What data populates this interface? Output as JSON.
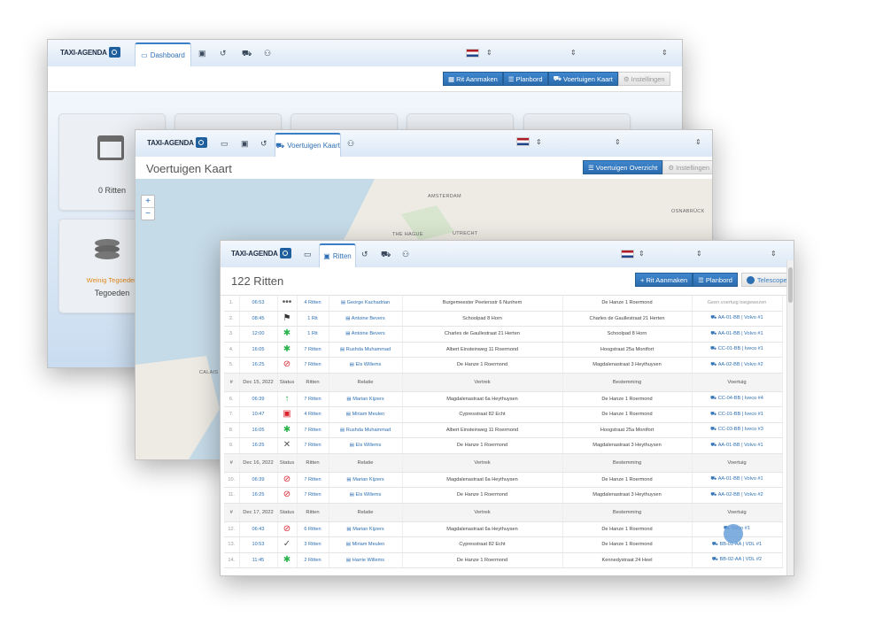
{
  "app": {
    "logo_text": "TAXI-AGENDA",
    "accent_color": "#2d6fb3"
  },
  "window1": {
    "active_tab": "Dashboard",
    "buttons": [
      "Rit Aanmaken",
      "Planbord",
      "Voertuigen Kaart",
      "Instellingen"
    ],
    "cards": [
      {
        "label": "0 Ritten"
      },
      {
        "label": "Weinig Tegoeden",
        "label2": "Tegoeden"
      }
    ]
  },
  "window2": {
    "active_tab": "Voertuigen Kaart",
    "title": "Voertuigen Kaart",
    "buttons": [
      "Voertuigen Overzicht",
      "Instellingen"
    ],
    "map_labels": [
      "AMSTERDAM",
      "THE HAGUE",
      "UTRECHT",
      "OSNABRÜCK",
      "CALAIS"
    ]
  },
  "window3": {
    "active_tab": "Ritten",
    "title": "122 Ritten",
    "buttons": [
      "+ Rit Aanmaken",
      "Planbord",
      "Telescope"
    ],
    "headers": [
      "#",
      "Status",
      "Ritten",
      "Relatie",
      "Vertrek",
      "Bestemming",
      "Voertuig"
    ],
    "groups": [
      {
        "date": null,
        "rows": [
          {
            "n": "1.",
            "time": "06:53",
            "status": "dots",
            "ritten": "4 Ritten",
            "relatie": "George Kachadrian",
            "vertrek": "Burgemeester Peetersstr 6 Nunhem",
            "bestemming": "De Hanze 1 Roermond",
            "voertuig": "Geen voertuig toegewezen"
          },
          {
            "n": "2.",
            "time": "08:45",
            "status": "flag",
            "ritten": "1 Rit",
            "relatie": "Antoine Bevers",
            "vertrek": "Schoolpad 8 Horn",
            "bestemming": "Charles de Gaullestraat 21 Herten",
            "voertuig": "AA-01-BB | Volvo #1"
          },
          {
            "n": "3.",
            "time": "12:00",
            "status": "star",
            "ritten": "1 Rit",
            "relatie": "Antoine Bevers",
            "vertrek": "Charles de Gaullestraat 21 Herten",
            "bestemming": "Schoolpad 8 Horn",
            "voertuig": "AA-01-BB | Volvo #1"
          },
          {
            "n": "4.",
            "time": "16:05",
            "status": "star",
            "ritten": "7 Ritten",
            "relatie": "Rushda Muhammad",
            "vertrek": "Albert Einsteinweg 11 Roermond",
            "bestemming": "Hoogstraat 25a Montfort",
            "voertuig": "CC-01-BB | Iveco #1"
          },
          {
            "n": "5.",
            "time": "16:25",
            "status": "ban",
            "ritten": "7 Ritten",
            "relatie": "Els Willems",
            "vertrek": "De Hanze 1 Roermond",
            "bestemming": "Magdalenastraat 3 Heythuysen",
            "voertuig": "AA-02-BB | Volvo #2"
          }
        ]
      },
      {
        "date": "Dec 15, 2022",
        "rows": [
          {
            "n": "6.",
            "time": "06:39",
            "status": "up",
            "ritten": "7 Ritten",
            "relatie": "Marian Kijzers",
            "vertrek": "Magdalenastraat 6a Heythuysen",
            "bestemming": "De Hanze 1 Roermond",
            "voertuig": "CC-04-BB | Iveco #4"
          },
          {
            "n": "7.",
            "time": "10:47",
            "status": "cal",
            "ritten": "4 Ritten",
            "relatie": "Miriam Meulen",
            "vertrek": "Cypresstraat 82 Echt",
            "bestemming": "De Hanze 1 Roermond",
            "voertuig": "CC-01-BB | Iveco #1"
          },
          {
            "n": "8.",
            "time": "16:05",
            "status": "star",
            "ritten": "7 Ritten",
            "relatie": "Rushda Muhammad",
            "vertrek": "Albert Einsteinweg 11 Roermond",
            "bestemming": "Hoogstraat 25a Montfort",
            "voertuig": "CC-03-BB | Iveco #3"
          },
          {
            "n": "9.",
            "time": "16:25",
            "status": "x",
            "ritten": "7 Ritten",
            "relatie": "Els Willems",
            "vertrek": "De Hanze 1 Roermond",
            "bestemming": "Magdalenastraat 3 Heythuysen",
            "voertuig": "AA-01-BB | Volvo #1"
          }
        ]
      },
      {
        "date": "Dec 16, 2022",
        "rows": [
          {
            "n": "10.",
            "time": "06:39",
            "status": "ban",
            "ritten": "7 Ritten",
            "relatie": "Marian Kijzers",
            "vertrek": "Magdalenastraat 6a Heythuysen",
            "bestemming": "De Hanze 1 Roermond",
            "voertuig": "AA-01-BB | Volvo #1"
          },
          {
            "n": "11.",
            "time": "16:25",
            "status": "ban",
            "ritten": "7 Ritten",
            "relatie": "Els Willems",
            "vertrek": "De Hanze 1 Roermond",
            "bestemming": "Magdalenastraat 3 Heythuysen",
            "voertuig": "AA-02-BB | Volvo #2"
          }
        ]
      },
      {
        "date": "Dec 17, 2022",
        "rows": [
          {
            "n": "12.",
            "time": "06:43",
            "status": "ban",
            "ritten": "6 Ritten",
            "relatie": "Marian Kijzers",
            "vertrek": "Magdalenastraat 6a Heythuysen",
            "bestemming": "De Hanze 1 Roermond",
            "voertuig": "Volvo #1"
          },
          {
            "n": "13.",
            "time": "10:53",
            "status": "check",
            "ritten": "3 Ritten",
            "relatie": "Miriam Meulen",
            "vertrek": "Cypresstraat 82 Echt",
            "bestemming": "De Hanze 1 Roermond",
            "voertuig": "BB-01-AA | VDL #1"
          },
          {
            "n": "14.",
            "time": "11:45",
            "status": "star",
            "ritten": "2 Ritten",
            "relatie": "Harrie Willems",
            "vertrek": "De Hanze 1 Roermond",
            "bestemming": "Kennedystraat 24 Heel",
            "voertuig": "BB-02-AA | VDL #2"
          }
        ]
      }
    ]
  }
}
